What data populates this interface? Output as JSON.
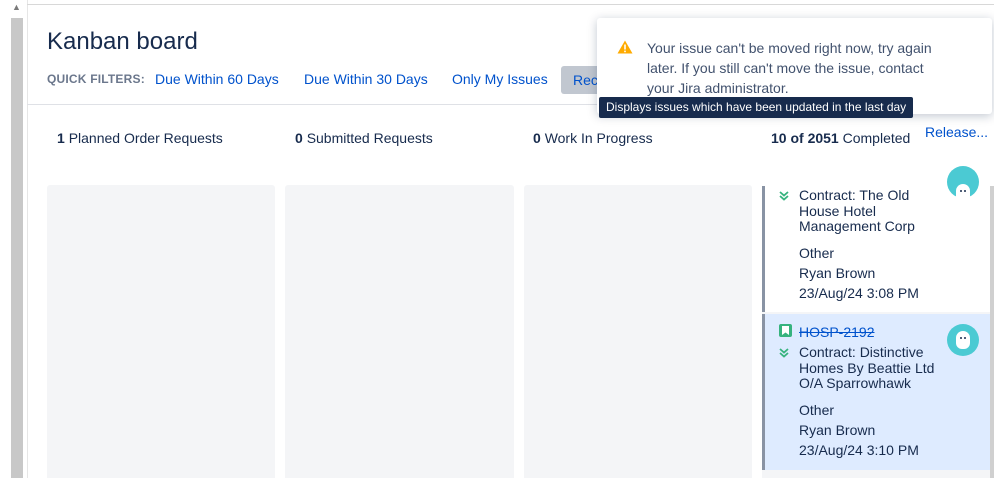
{
  "board": {
    "title": "Kanban board"
  },
  "quick_filters": {
    "label": "QUICK FILTERS:",
    "items": [
      "Due Within 60 Days",
      "Due Within 30 Days",
      "Only My Issues",
      "Rece"
    ]
  },
  "columns": [
    {
      "count": "1",
      "name": "Planned Order Requests"
    },
    {
      "count": "0",
      "name": "Submitted Requests"
    },
    {
      "count": "0",
      "name": "Work In Progress"
    },
    {
      "count": "10 of 2051",
      "name": "Completed"
    }
  ],
  "release_label": "Release...",
  "cards": [
    {
      "summary": "Contract: The Old House Hotel Management Corp",
      "type": "Other",
      "assignee": "Ryan Brown",
      "date": "23/Aug/24 3:08 PM"
    },
    {
      "key": "HOSP-2192",
      "summary": "Contract: Distinctive Homes By Beattie Ltd O/A Sparrowhawk",
      "type": "Other",
      "assignee": "Ryan Brown",
      "date": "23/Aug/24 3:10 PM"
    }
  ],
  "notification": {
    "message": "Your issue can't be moved right now, try again later. If you still can't move the issue, contact your Jira administrator."
  },
  "tooltip": {
    "text": "Displays issues which have been updated in the last day"
  },
  "colors": {
    "link": "#0052cc",
    "text": "#172b4d",
    "warning": "#ffab00",
    "selected_card": "#deebff",
    "avatar": "#4bcad3",
    "story": "#36b37e",
    "priority_low": "#36b37e"
  },
  "icons": {
    "warning": "warning-icon",
    "priority": "priority-lowest-icon",
    "issue_type": "story-icon",
    "avatar": "avatar-icon"
  }
}
